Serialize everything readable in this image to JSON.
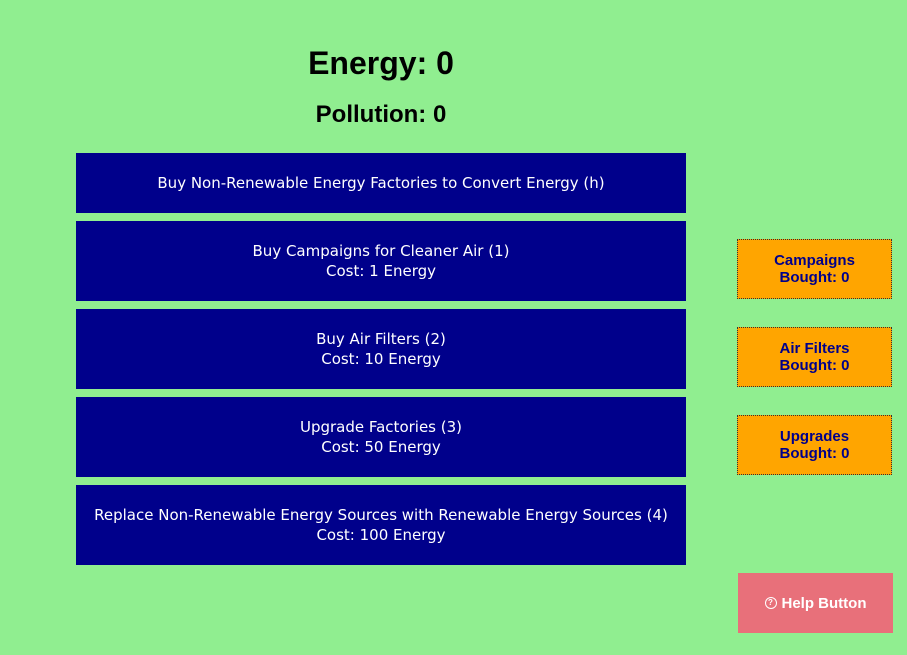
{
  "stats": {
    "energy_label": "Energy: ",
    "energy_value": "0",
    "pollution_label": "Pollution: ",
    "pollution_value": "0"
  },
  "actions": {
    "factories": {
      "label": "Buy Non-Renewable Energy Factories to Convert Energy (h)"
    },
    "campaigns": {
      "label": "Buy Campaigns for Cleaner Air (1)",
      "cost": "Cost: 1 Energy"
    },
    "air_filters": {
      "label": "Buy Air Filters (2)",
      "cost": "Cost: 10 Energy"
    },
    "upgrade": {
      "label": "Upgrade Factories (3)",
      "cost": "Cost: 50 Energy"
    },
    "replace": {
      "label": "Replace Non-Renewable Energy Sources with Renewable Energy Sources (4)",
      "cost": "Cost: 100 Energy"
    }
  },
  "counters": {
    "campaigns": {
      "label": "Campaigns",
      "bought": "Bought: 0"
    },
    "air_filters": {
      "label": "Air Filters",
      "bought": "Bought: 0"
    },
    "upgrades": {
      "label": "Upgrades",
      "bought": "Bought: 0"
    }
  },
  "help": {
    "icon": "question-circle-icon",
    "label": "Help Button"
  },
  "colors": {
    "background": "#90ee90",
    "action_button": "#00008b",
    "counter_box": "#ffa500",
    "help_button": "#e8707a"
  }
}
